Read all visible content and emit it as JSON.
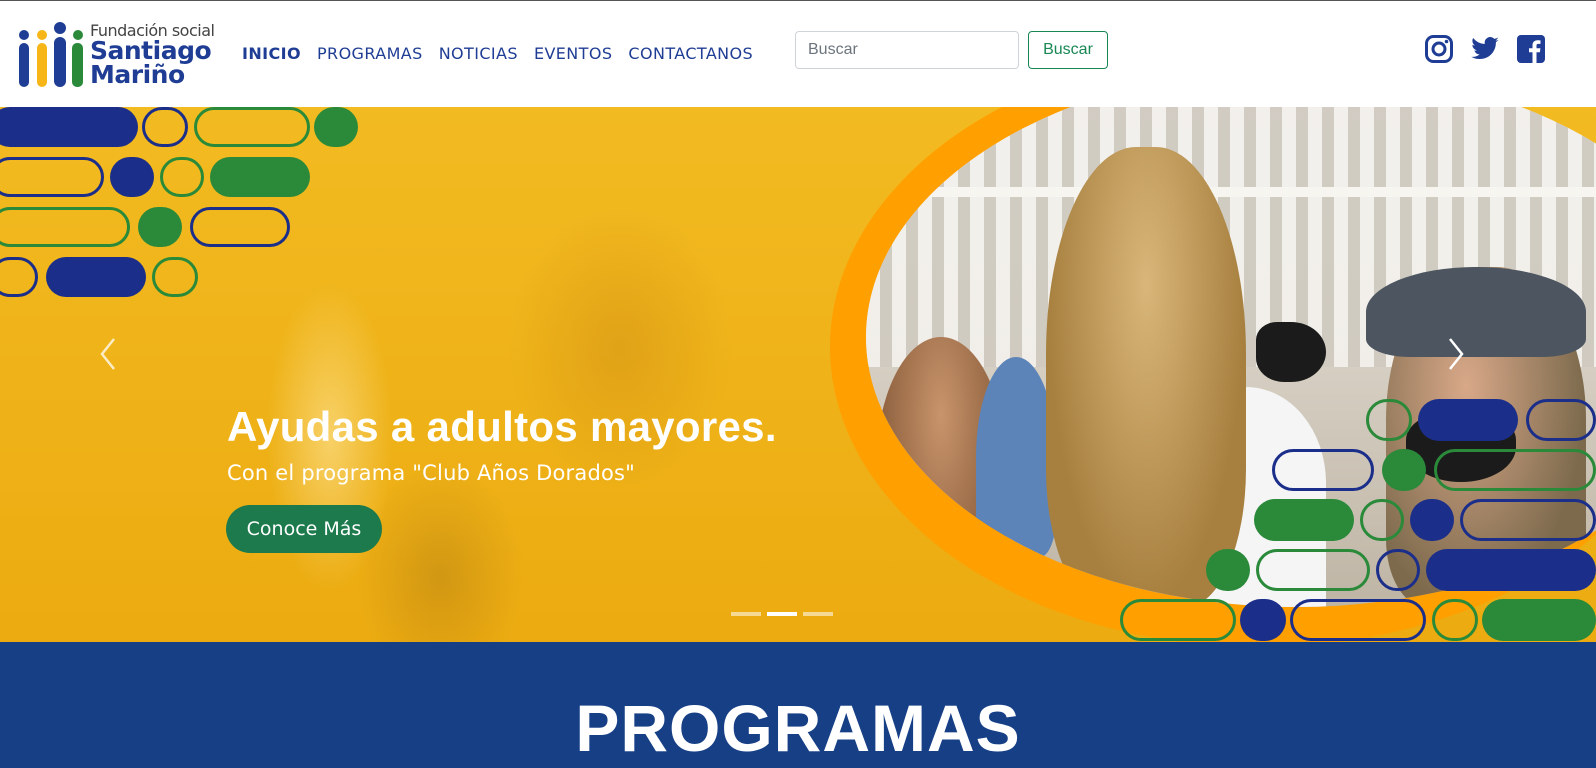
{
  "brand": {
    "line1": "Fundación social",
    "line2": "Santiago",
    "line3": "Mariño",
    "colors": {
      "blue": "#1f3d94",
      "yellow": "#f6b617",
      "green": "#2a8a3a"
    }
  },
  "nav": {
    "items": [
      {
        "label": "INICIO",
        "active": true
      },
      {
        "label": "PROGRAMAS",
        "active": false
      },
      {
        "label": "NOTICIAS",
        "active": false
      },
      {
        "label": "EVENTOS",
        "active": false
      },
      {
        "label": "CONTACTANOS",
        "active": false
      }
    ]
  },
  "search": {
    "placeholder": "Buscar",
    "value": "",
    "button_label": "Buscar"
  },
  "social": {
    "icons": [
      "instagram-icon",
      "twitter-icon",
      "facebook-icon"
    ],
    "color": "#1f3d94"
  },
  "hero": {
    "title": "Ayudas a adultos mayores.",
    "subtitle": "Con el programa \"Club Años Dorados\"",
    "button_label": "Conoce Más",
    "indicators_count": 3,
    "active_indicator": 2,
    "icons": {
      "prev": "chevron-left-icon",
      "next": "chevron-right-icon"
    },
    "colors": {
      "overlay": "#f6b617",
      "ring": "#ff9f00",
      "button": "#1c7a4d"
    }
  },
  "programs": {
    "title": "PROGRAMAS",
    "background": "#163f86"
  }
}
